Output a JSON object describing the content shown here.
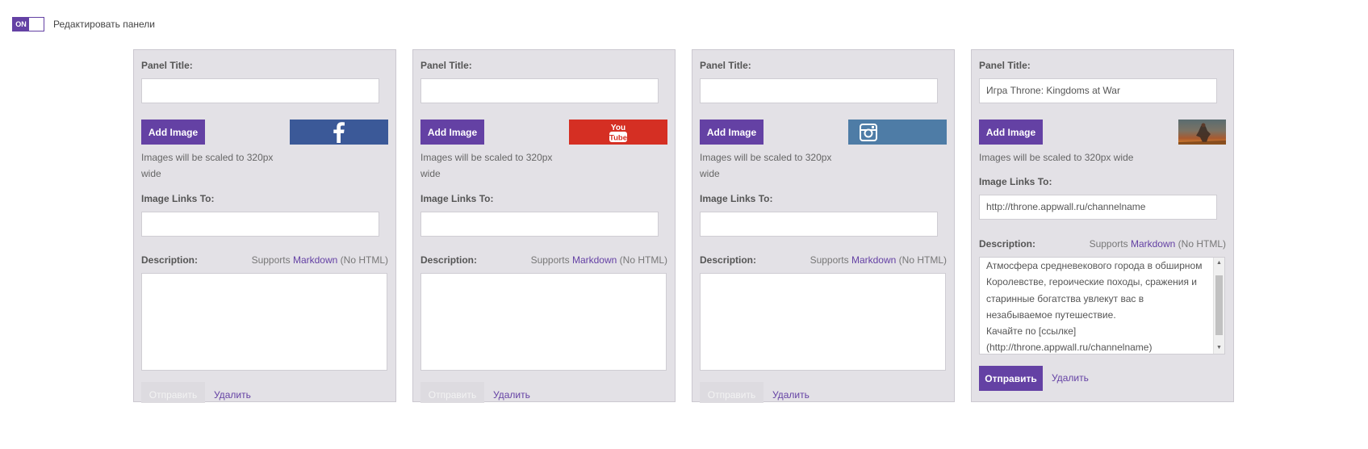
{
  "toggle": {
    "state": "ON",
    "label": "Редактировать панели"
  },
  "labels": {
    "panel_title": "Panel Title:",
    "add_image": "Add Image",
    "scale_hint": "Images will be scaled to 320px wide",
    "scale_hint_l1": "Images will be scaled to 320px",
    "scale_hint_l2": "wide",
    "image_links_to": "Image Links To:",
    "description": "Description:",
    "supports_prefix": "Supports",
    "markdown": "Markdown",
    "supports_suffix": "(No HTML)",
    "send": "Отправить",
    "delete": "Удалить"
  },
  "panels": [
    {
      "title_value": "",
      "image": "facebook-logo",
      "link_value": "",
      "description": "",
      "send_enabled": false
    },
    {
      "title_value": "",
      "image": "youtube-logo",
      "link_value": "",
      "description": "",
      "send_enabled": false
    },
    {
      "title_value": "",
      "image": "instagram-logo",
      "link_value": "",
      "description": "",
      "send_enabled": false
    },
    {
      "title_value": "Игра Throne: Kingdoms at War",
      "image": "game-artwork-thumbnail",
      "link_value": "http://throne.appwall.ru/channelname",
      "description_lines": [
        "Атмосфера средневекового города в обширном",
        "Королевстве, героические походы, сражения и",
        "старинные богатства увлекут вас в",
        "незабываемое путешествие.",
        "Качайте по [ссылке]",
        "(http://throne.appwall.ru/channelname)"
      ],
      "send_enabled": true
    }
  ],
  "colors": {
    "accent": "#6441a4",
    "panel_bg": "#e3e1e6",
    "facebook": "#3b5998",
    "youtube": "#d52f23",
    "instagram": "#4e7ca6"
  }
}
